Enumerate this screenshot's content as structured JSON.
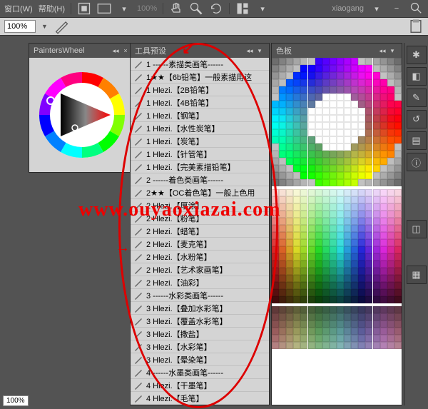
{
  "menubar": {
    "window": "窗口(W)",
    "help": "帮助(H)",
    "zoom": "100%",
    "user": "xiaogang"
  },
  "optbar": {
    "zoom_value": "100%"
  },
  "painters_wheel": {
    "title": "PaintersWheel"
  },
  "tool_presets": {
    "title": "工具预设",
    "items": [
      {
        "label": "1 ------素描类画笔------"
      },
      {
        "label": "1★★【6b铅笔】一般素描用这"
      },
      {
        "label": "1 Hlezi.【2B铅笔】"
      },
      {
        "label": "1 Hlezi.【4B铅笔】"
      },
      {
        "label": "1 Hlezi.【钢笔】"
      },
      {
        "label": "1 Hlezi.【水性炭笔】"
      },
      {
        "label": "1 Hlezi.【炭笔】"
      },
      {
        "label": "1 Hlezi.【针管笔】"
      },
      {
        "label": "1 Hlezi.【完美素描铅笔】"
      },
      {
        "label": "2 ------着色类画笔------"
      },
      {
        "label": "2★★【OC着色笔】一般上色用"
      },
      {
        "label": "2 Hlezi.【厚涂】"
      },
      {
        "label": "2 Hlezi.【粉笔】"
      },
      {
        "label": "2 Hlezi.【蜡笔】"
      },
      {
        "label": "2 Hlezi.【麦克笔】"
      },
      {
        "label": "2 Hlezi.【水粉笔】"
      },
      {
        "label": "2 Hlezi.【艺术家画笔】"
      },
      {
        "label": "2 Hlezi.【油彩】"
      },
      {
        "label": "3 ------水彩类画笔------"
      },
      {
        "label": "3 Hlezi.【叠加水彩笔】"
      },
      {
        "label": "3 Hlezi.【覆盖水彩笔】"
      },
      {
        "label": "3 Hlezi.【撒盐】"
      },
      {
        "label": "3 Hlezi.【水彩笔】"
      },
      {
        "label": "3 Hlezi.【晕染笔】"
      },
      {
        "label": "4 ------水墨类画笔------"
      },
      {
        "label": "4 Hlezi.【干墨笔】"
      },
      {
        "label": "4 Hlezi.【毛笔】"
      }
    ]
  },
  "swatches": {
    "title": "色板"
  },
  "watermark": "www.ouyaoxiazai.com",
  "zoom_bottom": "100%"
}
